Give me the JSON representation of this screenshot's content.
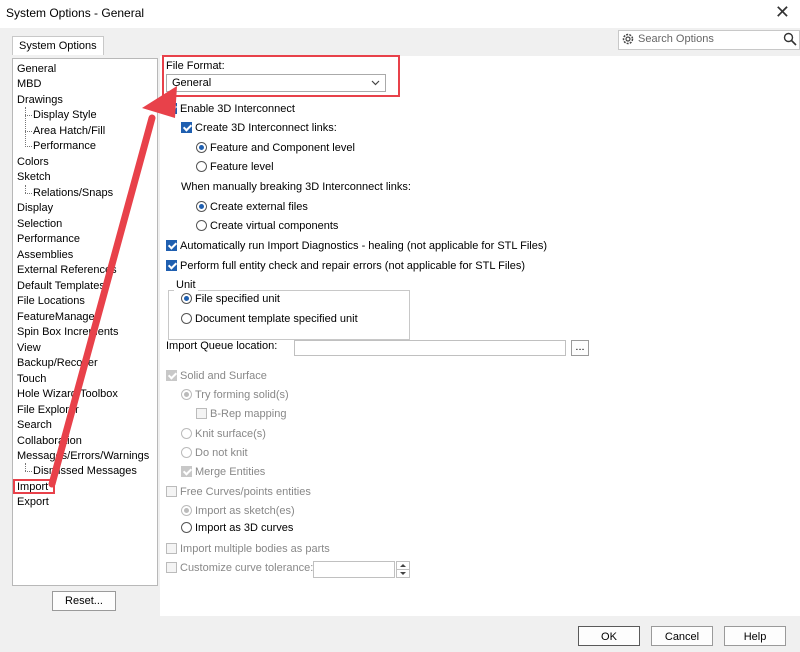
{
  "window": {
    "title": "System Options - General",
    "close_glyph": "✕"
  },
  "tabs": [
    {
      "label": "System Options"
    }
  ],
  "search": {
    "placeholder": "Search Options"
  },
  "nav": {
    "items": [
      {
        "label": "General",
        "indent": 0
      },
      {
        "label": "MBD",
        "indent": 0
      },
      {
        "label": "Drawings",
        "indent": 0
      },
      {
        "label": "Display Style",
        "indent": 1
      },
      {
        "label": "Area Hatch/Fill",
        "indent": 1
      },
      {
        "label": "Performance",
        "indent": 1
      },
      {
        "label": "Colors",
        "indent": 0
      },
      {
        "label": "Sketch",
        "indent": 0
      },
      {
        "label": "Relations/Snaps",
        "indent": 1
      },
      {
        "label": "Display",
        "indent": 0
      },
      {
        "label": "Selection",
        "indent": 0
      },
      {
        "label": "Performance",
        "indent": 0
      },
      {
        "label": "Assemblies",
        "indent": 0
      },
      {
        "label": "External References",
        "indent": 0
      },
      {
        "label": "Default Templates",
        "indent": 0
      },
      {
        "label": "File Locations",
        "indent": 0
      },
      {
        "label": "FeatureManager",
        "indent": 0
      },
      {
        "label": "Spin Box Increments",
        "indent": 0
      },
      {
        "label": "View",
        "indent": 0
      },
      {
        "label": "Backup/Recover",
        "indent": 0
      },
      {
        "label": "Touch",
        "indent": 0
      },
      {
        "label": "Hole Wizard/Toolbox",
        "indent": 0
      },
      {
        "label": "File Explorer",
        "indent": 0
      },
      {
        "label": "Search",
        "indent": 0
      },
      {
        "label": "Collaboration",
        "indent": 0
      },
      {
        "label": "Messages/Errors/Warnings",
        "indent": 0
      },
      {
        "label": "Dismissed Messages",
        "indent": 1
      },
      {
        "label": "Import",
        "indent": 0
      },
      {
        "label": "Export",
        "indent": 0
      }
    ],
    "reset_label": "Reset..."
  },
  "settings": {
    "file_format_label": "File Format:",
    "file_format_value": "General",
    "enable_3d_interconnect": {
      "label": "Enable 3D Interconnect",
      "checked": true
    },
    "create_links": {
      "label": "Create 3D Interconnect links:",
      "checked": true
    },
    "feature_component": {
      "label": "Feature and Component level",
      "selected": true
    },
    "feature_level": {
      "label": "Feature level",
      "selected": false
    },
    "breaking_label": "When manually breaking 3D Interconnect links:",
    "create_external": {
      "label": "Create external files",
      "selected": true
    },
    "create_virtual": {
      "label": "Create virtual components",
      "selected": false
    },
    "auto_diagnostics": {
      "label": "Automatically run Import Diagnostics - healing (not applicable for STL Files)",
      "checked": true
    },
    "full_entity_check": {
      "label": "Perform full entity check and repair errors (not applicable for STL Files)",
      "checked": true
    },
    "unit_group_label": "Unit",
    "file_specified_unit": {
      "label": "File specified unit",
      "selected": true
    },
    "document_template_unit": {
      "label": "Document template specified unit",
      "selected": false
    },
    "import_queue_label": "Import Queue location:",
    "import_queue_value": "",
    "browse_label": "...",
    "solid_surface": {
      "label": "Solid and Surface",
      "checked": true
    },
    "try_forming": {
      "label": "Try forming solid(s)",
      "selected": true
    },
    "brep_mapping": {
      "label": "B-Rep mapping",
      "checked": false
    },
    "knit_surface": {
      "label": "Knit surface(s)",
      "selected": false
    },
    "do_not_knit": {
      "label": "Do not knit",
      "selected": false
    },
    "merge_entities": {
      "label": "Merge Entities",
      "checked": true
    },
    "free_curves": {
      "label": "Free Curves/points entities",
      "checked": false
    },
    "import_as_sketch": {
      "label": "Import as sketch(es)",
      "selected": true
    },
    "import_as_3d_curves": {
      "label": "Import as 3D curves",
      "selected": false
    },
    "import_multiple_bodies": {
      "label": "Import multiple bodies as parts",
      "checked": false
    },
    "customize_curve_tolerance": {
      "label": "Customize curve tolerance:",
      "checked": false
    },
    "curve_tolerance_value": ""
  },
  "footer": {
    "ok_label": "OK",
    "cancel_label": "Cancel",
    "help_label": "Help"
  },
  "colors": {
    "accent": "#1f5fb0",
    "annotation": "#e8414a"
  }
}
